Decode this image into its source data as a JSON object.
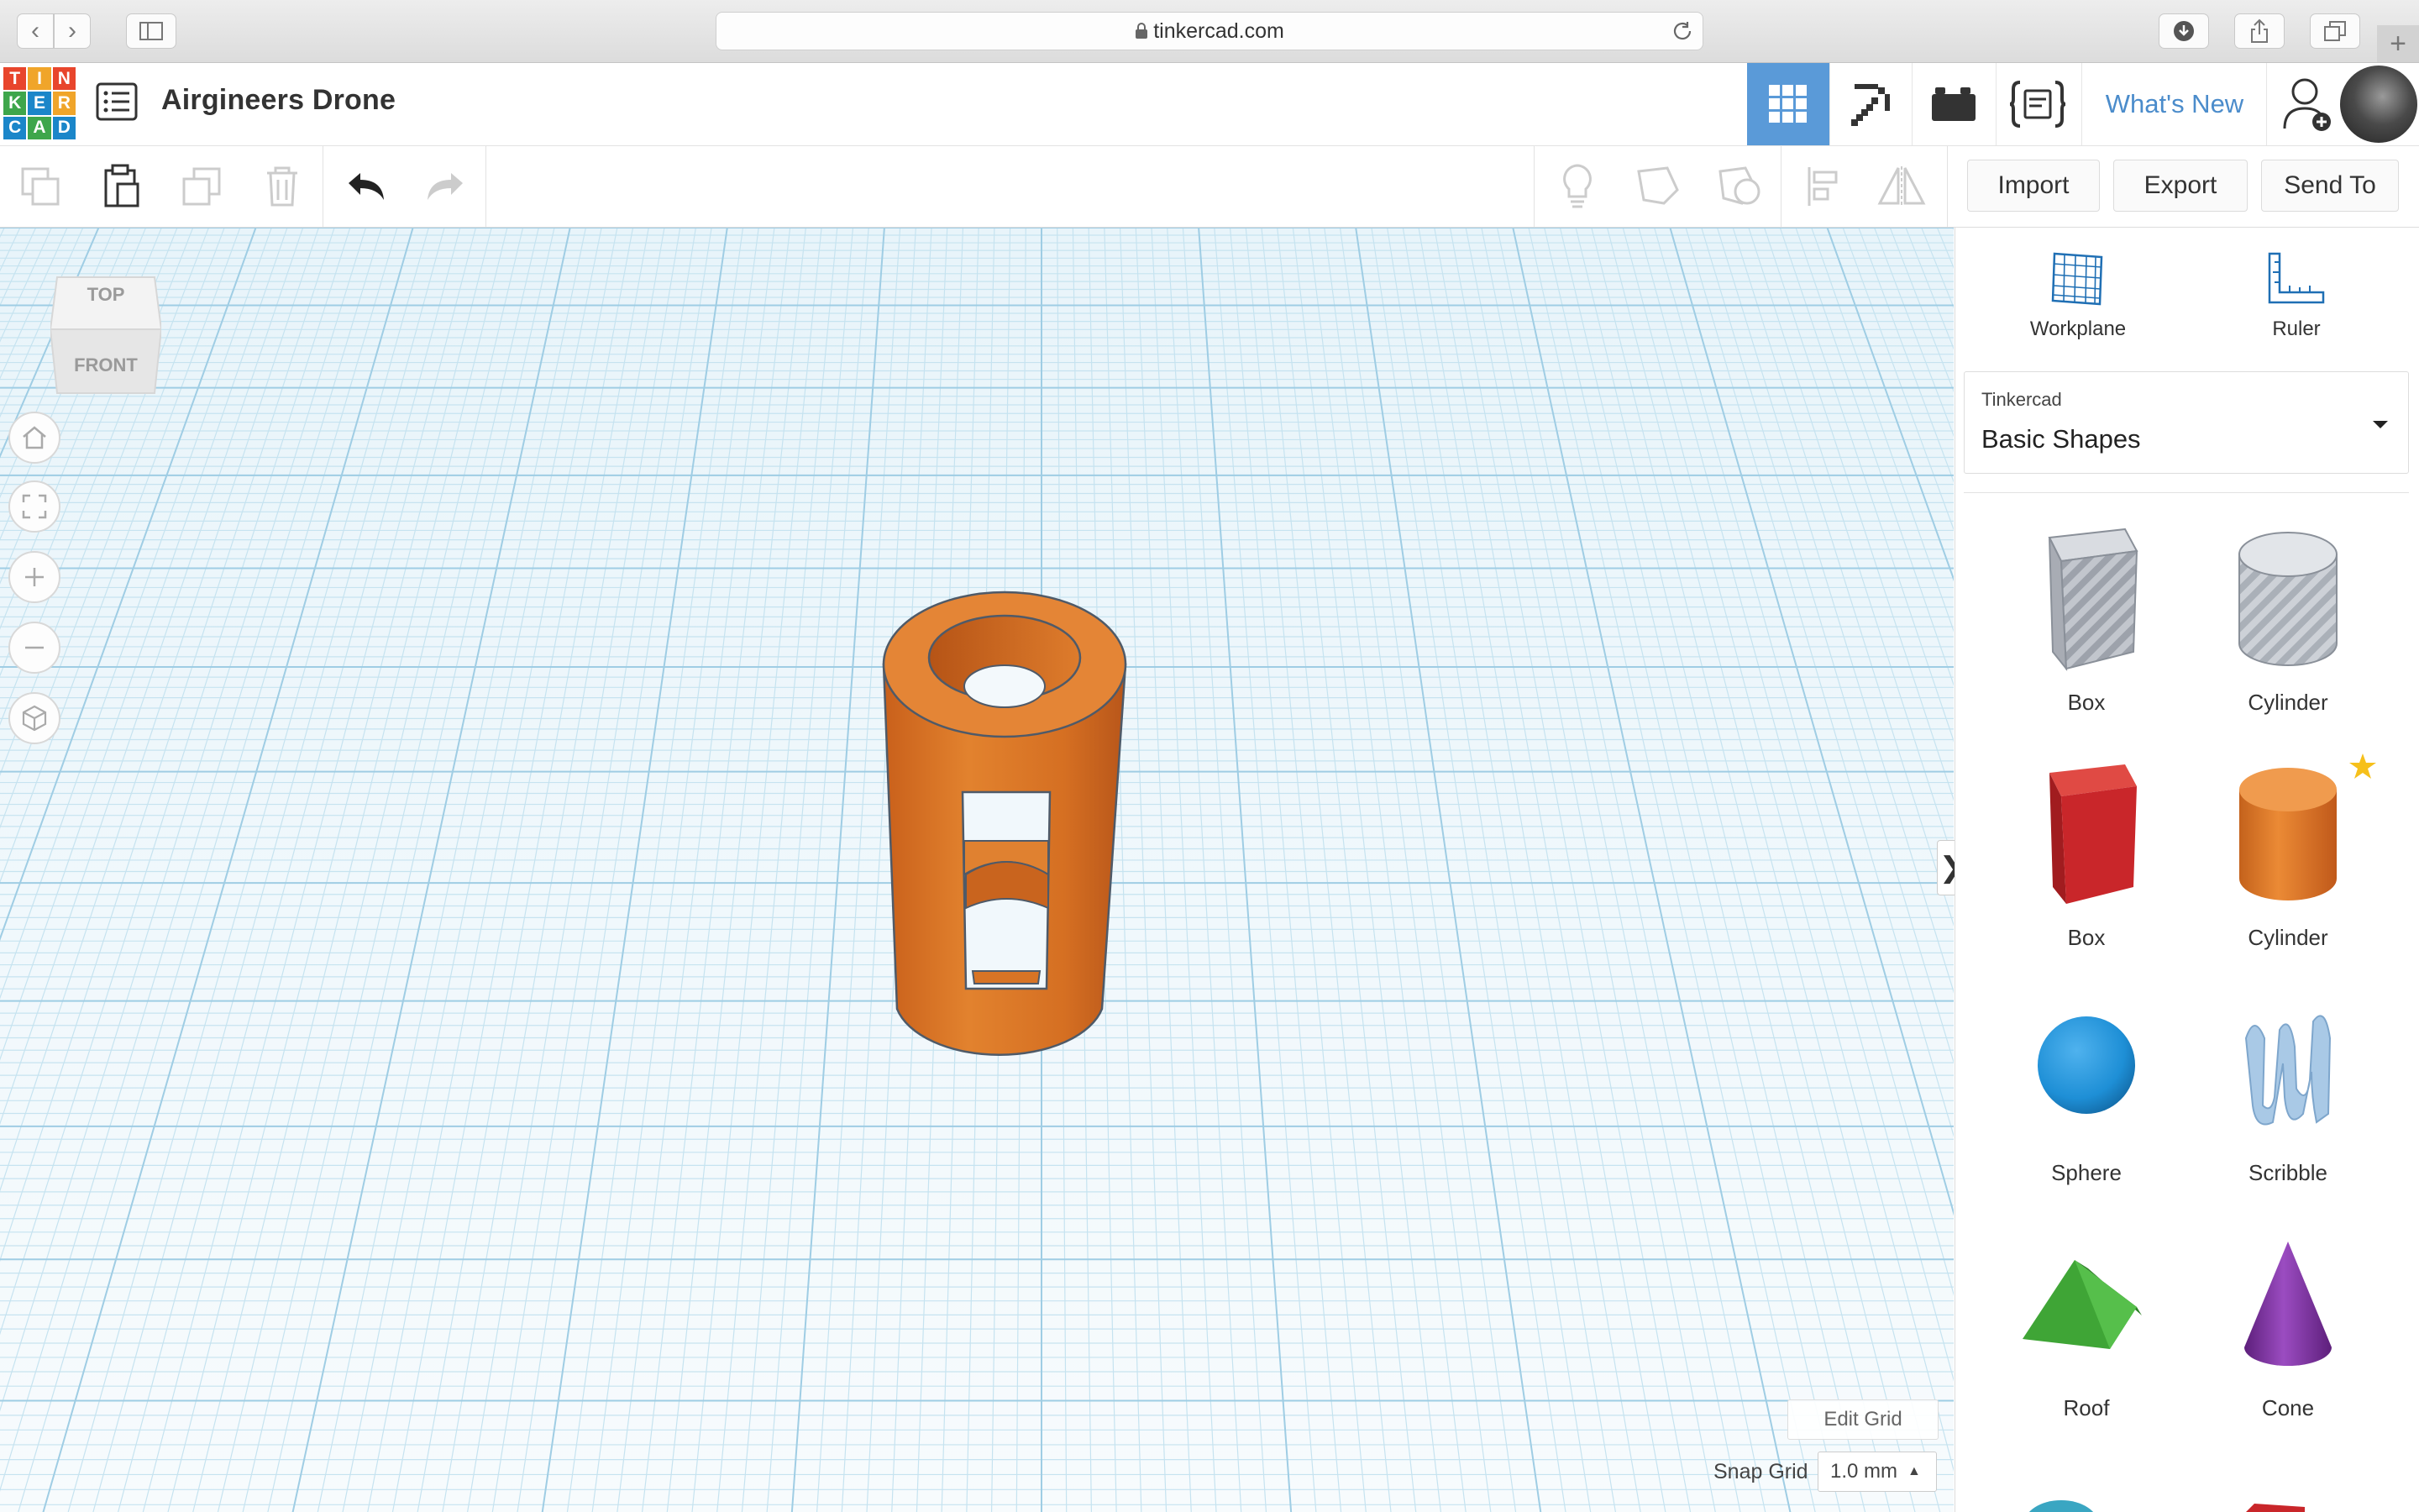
{
  "browser": {
    "url": "tinkercad.com"
  },
  "header": {
    "logo_letters": [
      "T",
      "I",
      "N",
      "K",
      "E",
      "R",
      "C",
      "A",
      "D"
    ],
    "project_title": "Airgineers Drone",
    "whats_new": "What's New"
  },
  "toolbar": {
    "import_label": "Import",
    "export_label": "Export",
    "send_to_label": "Send To"
  },
  "view_cube": {
    "top_label": "TOP",
    "front_label": "FRONT"
  },
  "right_panel": {
    "workplane_label": "Workplane",
    "ruler_label": "Ruler",
    "library_provider": "Tinkercad",
    "library_name": "Basic Shapes",
    "shapes": [
      {
        "label": "Box",
        "color": "#b8bcc4",
        "kind": "hole-box"
      },
      {
        "label": "Cylinder",
        "color": "#c4c8ce",
        "kind": "hole-cylinder"
      },
      {
        "label": "Box",
        "color": "#c9262a",
        "kind": "box"
      },
      {
        "label": "Cylinder",
        "color": "#e07a25",
        "kind": "cylinder",
        "favorite": true
      },
      {
        "label": "Sphere",
        "color": "#1e8fd6",
        "kind": "sphere"
      },
      {
        "label": "Scribble",
        "color": "#a9c9e6",
        "kind": "scribble"
      },
      {
        "label": "Roof",
        "color": "#3fa536",
        "kind": "roof"
      },
      {
        "label": "Cone",
        "color": "#7b2f9e",
        "kind": "cone"
      }
    ]
  },
  "bottom": {
    "edit_grid": "Edit Grid",
    "snap_grid_label": "Snap Grid",
    "snap_grid_value": "1.0 mm"
  },
  "colors": {
    "accent": "#4b8ccb",
    "active_tab": "#5a9ad8",
    "object": "#e07a25",
    "grid_line": "#bfe0ef"
  }
}
